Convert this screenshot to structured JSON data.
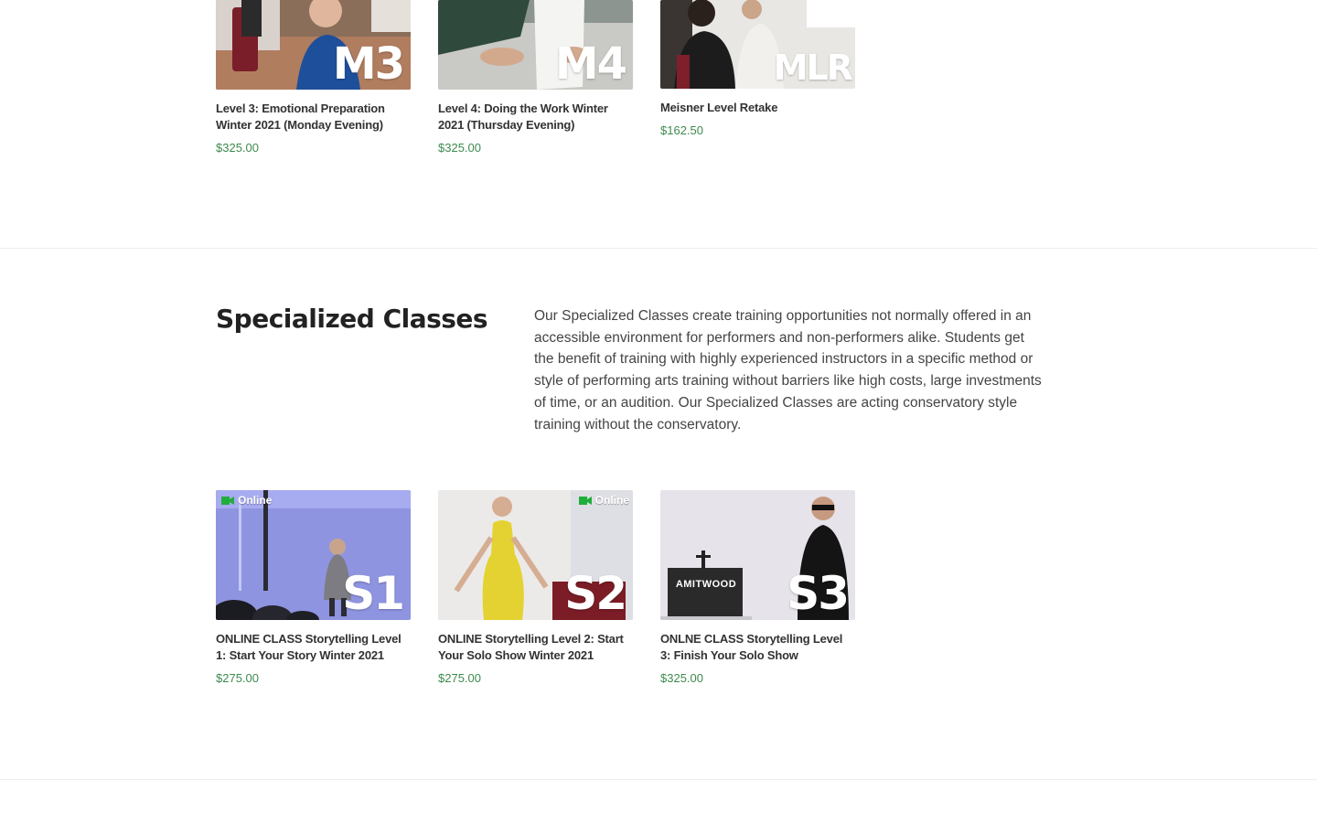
{
  "top_products": [
    {
      "code": "M3",
      "title": "Level 3: Emotional Preparation Winter 2021 (Monday Evening)",
      "price": "$325.00"
    },
    {
      "code": "M4",
      "title": "Level 4: Doing the Work Winter 2021 (Thursday Evening)",
      "price": "$325.00"
    },
    {
      "code": "MLR",
      "title": "Meisner Level Retake",
      "price": "$162.50"
    }
  ],
  "specialized": {
    "heading": "Specialized Classes",
    "description": "Our Specialized Classes create training opportunities not normally offered in an accessible environment for performers and non-performers alike. Students get the benefit of training with highly experienced instructors in a specific method or style of performing arts training without barriers like high costs, large investments of time, or an audition. Our Specialized Classes are acting conservatory style training without the conservatory.",
    "products": [
      {
        "code": "S1",
        "badge": "Online",
        "title": "ONLINE CLASS Storytelling Level 1: Start Your Story Winter 2021",
        "price": "$275.00"
      },
      {
        "code": "S2",
        "badge": "Online",
        "title": "ONLINE Storytelling Level 2: Start Your Solo Show Winter 2021",
        "price": "$275.00"
      },
      {
        "code": "S3",
        "sign": "AMITWOOD",
        "title": "ONLNE CLASS Storytelling Level 3: Finish Your Solo Show",
        "price": "$325.00"
      }
    ]
  },
  "colors": {
    "price": "#3d8a4e",
    "heading": "#222222",
    "divider": "#ececec",
    "online_badge_icon": "#1fae3b"
  },
  "icons": {
    "online_badge": "video-camera-icon"
  }
}
